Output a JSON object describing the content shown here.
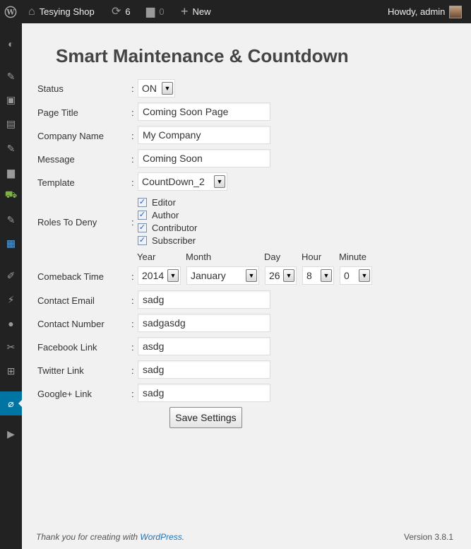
{
  "adminbar": {
    "site_name": "Tesying Shop",
    "updates_count": "6",
    "comments_count": "0",
    "new_label": "New",
    "howdy": "Howdy, admin"
  },
  "page": {
    "title": "Smart Maintenance & Countdown"
  },
  "form": {
    "colon": ":",
    "status": {
      "label": "Status",
      "value": "ON"
    },
    "page_title": {
      "label": "Page Title",
      "value": "Coming Soon Page"
    },
    "company_name": {
      "label": "Company Name",
      "value": "My Company"
    },
    "message": {
      "label": "Message",
      "value": "Coming Soon"
    },
    "template": {
      "label": "Template",
      "value": "CountDown_2"
    },
    "roles": {
      "label": "Roles To Deny",
      "items": [
        {
          "label": "Editor",
          "checked": true
        },
        {
          "label": "Author",
          "checked": true
        },
        {
          "label": "Contributor",
          "checked": true
        },
        {
          "label": "Subscriber",
          "checked": true
        }
      ]
    },
    "comeback": {
      "label": "Comeback Time",
      "year_label": "Year",
      "year": "2014",
      "month_label": "Month",
      "month": "January",
      "day_label": "Day",
      "day": "26",
      "hour_label": "Hour",
      "hour": "8",
      "minute_label": "Minute",
      "minute": "0"
    },
    "contact_email": {
      "label": "Contact Email",
      "value": "sadg"
    },
    "contact_number": {
      "label": "Contact Number",
      "value": "sadgasdg"
    },
    "facebook": {
      "label": "Facebook Link",
      "value": "asdg"
    },
    "twitter": {
      "label": "Twitter Link",
      "value": "sadg"
    },
    "googleplus": {
      "label": "Google+ Link",
      "value": "sadg"
    },
    "save_label": "Save Settings"
  },
  "footer": {
    "thanks_prefix": "Thank you for creating with ",
    "wp_link": "WordPress",
    "thanks_suffix": ".",
    "version": "Version 3.8.1"
  },
  "colors": {
    "adminbar_bg": "#222222",
    "menu_current": "#0074a2",
    "content_bg": "#f1f1f1"
  }
}
